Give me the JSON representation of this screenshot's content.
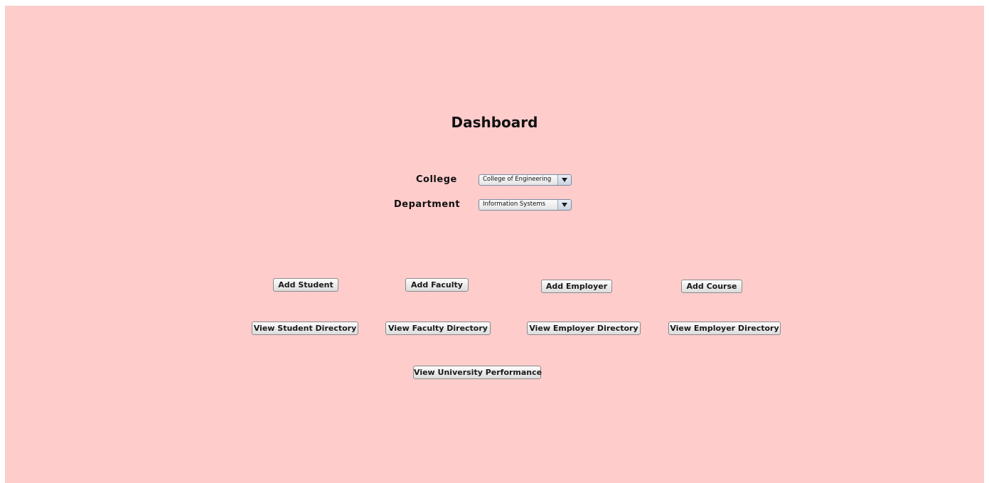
{
  "header": {
    "title": "Dashboard"
  },
  "filters": {
    "college_label": "College",
    "college_value": "College of Engineering",
    "department_label": "Department",
    "department_value": "Information Systems"
  },
  "actions": {
    "add_student": "Add Student",
    "add_faculty": "Add Faculty",
    "add_employer": "Add Employer",
    "add_course": "Add Course",
    "view_student_directory": "View Student Directory",
    "view_faculty_directory": "View Faculty Directory",
    "view_employer_directory": "View Employer Directory",
    "view_employer_directory_2": "View Employer Directory",
    "view_university_performance": "View University Performance"
  },
  "colors": {
    "background": "#ffcccc"
  }
}
